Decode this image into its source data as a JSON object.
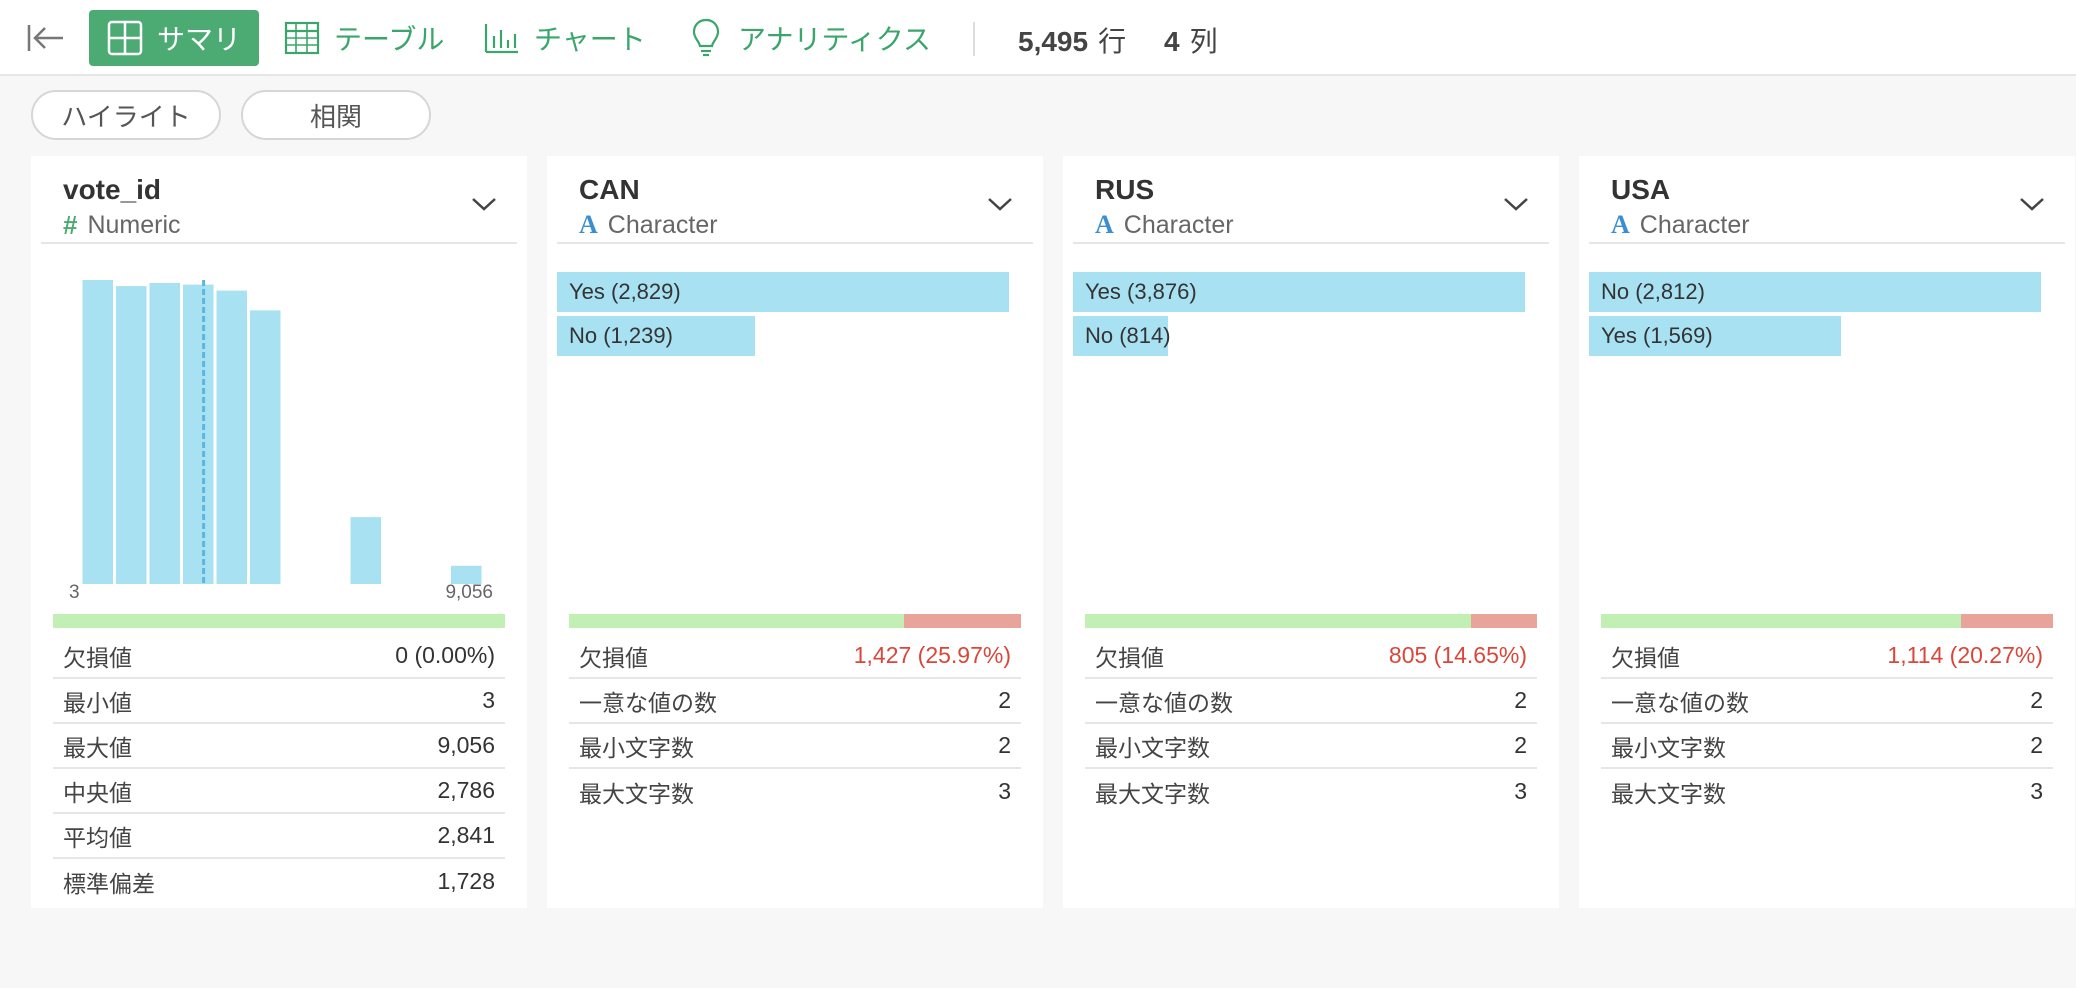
{
  "toolbar": {
    "tabs": {
      "summary": "サマリ",
      "table": "テーブル",
      "chart": "チャート",
      "analytics": "アナリティクス"
    },
    "rows": {
      "value": "5,495",
      "unit": "行"
    },
    "cols": {
      "value": "4",
      "unit": "列"
    }
  },
  "subbar": {
    "highlight": "ハイライト",
    "correlation": "相関"
  },
  "colors": {
    "accent": "#4bab73",
    "bar": "#a8e1f2",
    "ok": "#c2efb3",
    "missing": "#e8a49a",
    "missing_text": "#d9473a"
  },
  "columns": [
    {
      "name": "vote_id",
      "type_icon": "#",
      "type": "Numeric",
      "hist_min": "3",
      "hist_max": "9,056",
      "missing_fraction": 0.0,
      "stats": [
        {
          "label": "欠損値",
          "value": "0 (0.00%)"
        },
        {
          "label": "最小値",
          "value": "3"
        },
        {
          "label": "最大値",
          "value": "9,056"
        },
        {
          "label": "中央値",
          "value": "2,786"
        },
        {
          "label": "平均値",
          "value": "2,841"
        },
        {
          "label": "標準偏差",
          "value": "1,728"
        }
      ]
    },
    {
      "name": "CAN",
      "type_icon": "A",
      "type": "Character",
      "missing_fraction": 0.2597,
      "bars": [
        {
          "label": "Yes (2,829)",
          "fraction": 1.0
        },
        {
          "label": "No (1,239)",
          "fraction": 0.438
        }
      ],
      "stats": [
        {
          "label": "欠損値",
          "value": "1,427 (25.97%)"
        },
        {
          "label": "一意な値の数",
          "value": "2"
        },
        {
          "label": "最小文字数",
          "value": "2"
        },
        {
          "label": "最大文字数",
          "value": "3"
        }
      ]
    },
    {
      "name": "RUS",
      "type_icon": "A",
      "type": "Character",
      "missing_fraction": 0.1465,
      "bars": [
        {
          "label": "Yes (3,876)",
          "fraction": 1.0
        },
        {
          "label": "No (814)",
          "fraction": 0.21
        }
      ],
      "stats": [
        {
          "label": "欠損値",
          "value": "805 (14.65%)"
        },
        {
          "label": "一意な値の数",
          "value": "2"
        },
        {
          "label": "最小文字数",
          "value": "2"
        },
        {
          "label": "最大文字数",
          "value": "3"
        }
      ]
    },
    {
      "name": "USA",
      "type_icon": "A",
      "type": "Character",
      "missing_fraction": 0.2027,
      "bars": [
        {
          "label": "No (2,812)",
          "fraction": 1.0
        },
        {
          "label": "Yes (1,569)",
          "fraction": 0.558
        }
      ],
      "stats": [
        {
          "label": "欠損値",
          "value": "1,114 (20.27%)"
        },
        {
          "label": "一意な値の数",
          "value": "2"
        },
        {
          "label": "最小文字数",
          "value": "2"
        },
        {
          "label": "最大文字数",
          "value": "3"
        }
      ]
    }
  ],
  "chart_data": {
    "type": "bar",
    "x": [
      "3",
      "9,056"
    ],
    "values": [
      1.0,
      0.98,
      0.99,
      0.985,
      0.965,
      0.9,
      0.0,
      0.0,
      0.22,
      0.0,
      0.0,
      0.06
    ],
    "median_line_fraction": 0.305,
    "title": "",
    "xlabel": "",
    "ylabel": ""
  }
}
